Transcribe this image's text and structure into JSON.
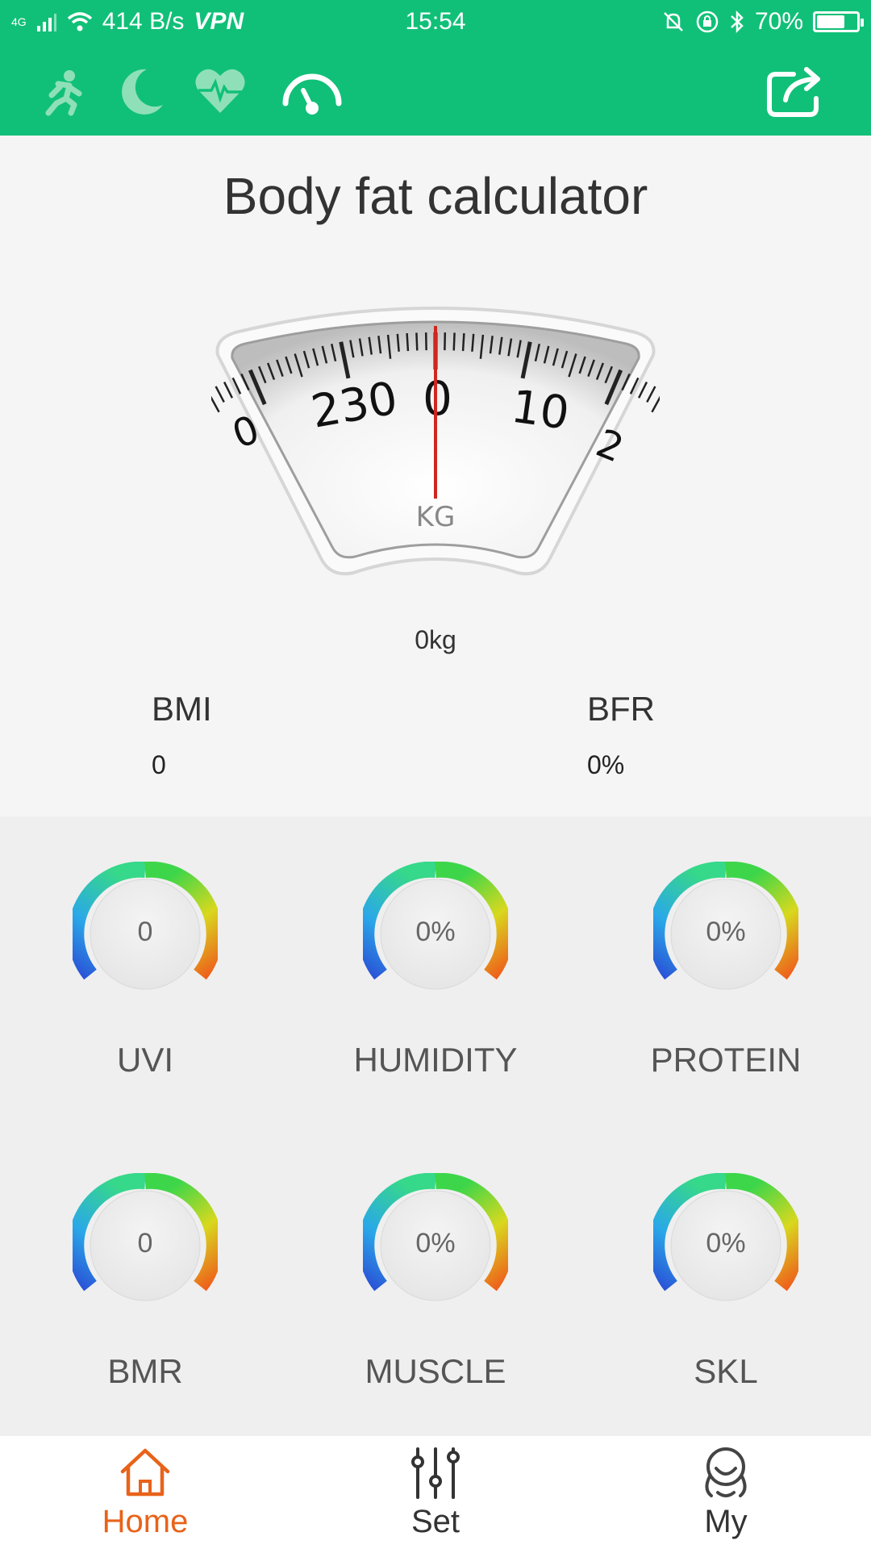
{
  "status_bar": {
    "network": "4G",
    "speed": "414 B/s",
    "vpn": "VPN",
    "time": "15:54",
    "battery": "70%",
    "battery_level": 0.7
  },
  "toolbar": {
    "icons": [
      "running-icon",
      "moon-icon",
      "heart-rate-icon",
      "scale-gauge-icon",
      "share-icon"
    ],
    "active": "scale-gauge-icon"
  },
  "page": {
    "title": "Body fat calculator"
  },
  "scale": {
    "dial_labels": [
      "0",
      "230",
      "0",
      "10",
      "2"
    ],
    "unit": "KG",
    "reading": "0kg"
  },
  "metrics": {
    "bmi": {
      "label": "BMI",
      "value": "0"
    },
    "bfr": {
      "label": "BFR",
      "value": "0%"
    }
  },
  "gauges": [
    {
      "label": "UVI",
      "value": "0"
    },
    {
      "label": "HUMIDITY",
      "value": "0%"
    },
    {
      "label": "PROTEIN",
      "value": "0%"
    },
    {
      "label": "BMR",
      "value": "0"
    },
    {
      "label": "MUSCLE",
      "value": "0%"
    },
    {
      "label": "SKL",
      "value": "0%"
    }
  ],
  "bottom_nav": {
    "items": [
      {
        "label": "Home",
        "icon": "home-icon",
        "active": true
      },
      {
        "label": "Set",
        "icon": "sliders-icon",
        "active": false
      },
      {
        "label": "My",
        "icon": "user-icon",
        "active": false
      }
    ]
  },
  "colors": {
    "brand_green": "#11c078",
    "active_orange": "#e8631a",
    "inactive_nav": "#333333",
    "scale_needle": "#d0271d"
  }
}
